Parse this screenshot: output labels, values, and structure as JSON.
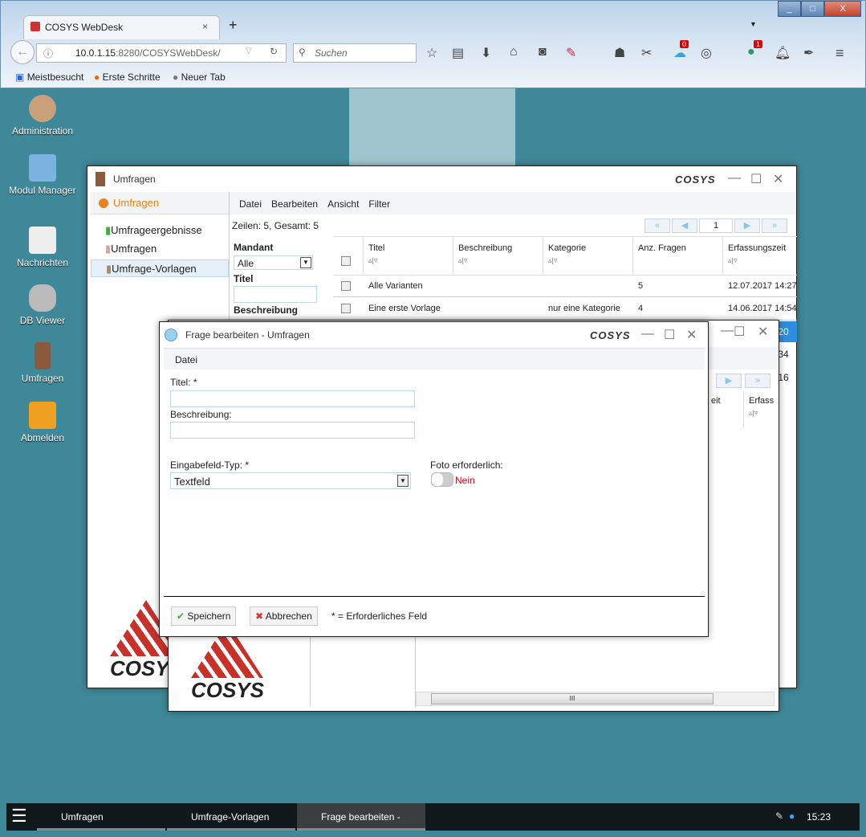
{
  "browser": {
    "tab_title": "COSYS WebDesk",
    "new_tab": "+",
    "url_host": "10.0.1.15",
    "url_rest": ":8280/COSYSWebDesk/",
    "search_placeholder": "Suchen",
    "badge_a": "0",
    "badge_b": "1",
    "bookmarks": [
      "Meistbesucht",
      "Erste Schritte",
      "Neuer Tab"
    ],
    "window_buttons": [
      "_",
      "□",
      "X"
    ]
  },
  "desktop": {
    "icons": [
      {
        "label": "Administration"
      },
      {
        "label": "Modul Manager"
      },
      {
        "label": "Nachrichten"
      },
      {
        "label": "DB Viewer"
      },
      {
        "label": "Umfragen"
      },
      {
        "label": "Abmelden"
      }
    ]
  },
  "umfragen_window": {
    "title": "Umfragen",
    "brand": "COSYS",
    "nav_header": "Umfragen",
    "nav_items": [
      "Umfrageergebnisse",
      "Umfragen",
      "Umfrage-Vorlagen"
    ],
    "menu": [
      "Datei",
      "Bearbeiten",
      "Ansicht",
      "Filter"
    ],
    "row_count": "Zeilen: 5, Gesamt: 5",
    "page": "1",
    "filters": {
      "mandant_label": "Mandant",
      "mandant_value": "Alle",
      "titel_label": "Titel",
      "beschreibung_label": "Beschreibung"
    },
    "columns": [
      "Titel",
      "Beschreibung",
      "Kategorie",
      "Anz. Fragen",
      "Erfassungszeit"
    ],
    "rows": [
      {
        "titel": "Alle Varianten",
        "beschreibung": "",
        "kategorie": "",
        "anz": "5",
        "zeit": "12.07.2017 14:27"
      },
      {
        "titel": "Eine erste Vorlage",
        "beschreibung": "",
        "kategorie": "nur eine Kategorie",
        "anz": "4",
        "zeit": "14.06.2017 14:54"
      }
    ],
    "partial_times": [
      ":20",
      ":34",
      ":16"
    ]
  },
  "vorlagen_window": {
    "col_partial_a": "eit",
    "col_partial_b": "Erfass",
    "scroll_grip": "III"
  },
  "dialog": {
    "title": "Frage bearbeiten - Umfragen",
    "brand": "COSYS",
    "menu": [
      "Datei"
    ],
    "titel_label": "Titel: *",
    "titel_value": "",
    "beschreibung_label": "Beschreibung:",
    "beschreibung_value": "",
    "typ_label": "Eingabefeld-Typ: *",
    "typ_value": "Textfeld",
    "foto_label": "Foto erforderlich:",
    "foto_value": "Nein",
    "save": "Speichern",
    "cancel": "Abbrechen",
    "required_note": "* = Erforderliches Feld"
  },
  "taskbar": {
    "items": [
      "Umfragen",
      "Umfrage-Vorlagen",
      "Frage bearbeiten -"
    ],
    "clock": "15:23"
  },
  "colors": {
    "desktop": "#3f8899",
    "accent_orange": "#e8821e",
    "nein_red": "#e0001a",
    "selection_blue": "#2d8ee0"
  }
}
